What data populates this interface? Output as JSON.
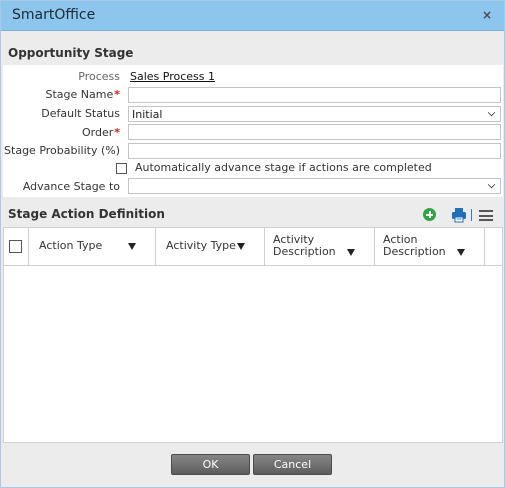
{
  "window": {
    "title": "SmartOffice",
    "close_label": "×"
  },
  "opportunity_stage": {
    "heading": "Opportunity Stage",
    "process_label": "Process",
    "process_value": "Sales Process 1",
    "stage_name_label": "Stage Name",
    "stage_name_value": "",
    "required_marker": "*",
    "default_status_label": "Default Status",
    "default_status_value": "Initial",
    "order_label": "Order",
    "order_value": "",
    "stage_probability_label": "Stage Probability (%)",
    "stage_probability_value": "",
    "auto_advance_label": "Automatically advance stage if actions are completed",
    "auto_advance_checked": false,
    "advance_stage_label": "Advance Stage to",
    "advance_stage_value": ""
  },
  "stage_action_definition": {
    "heading": "Stage Action Definition",
    "icons": [
      "add-icon",
      "print-icon",
      "menu-icon"
    ],
    "columns": [
      {
        "line1": "Action Type",
        "line2": ""
      },
      {
        "line1": "Activity Type",
        "line2": ""
      },
      {
        "line1": "Activity",
        "line2": "Description"
      },
      {
        "line1": "Action",
        "line2": "Description"
      }
    ],
    "rows": []
  },
  "footer": {
    "ok_label": "OK",
    "cancel_label": "Cancel"
  },
  "colors": {
    "titlebar": "#8cc6ec",
    "required": "#cc1f1f",
    "add_icon": "#2ea640",
    "print_icon": "#1f6fb9"
  }
}
